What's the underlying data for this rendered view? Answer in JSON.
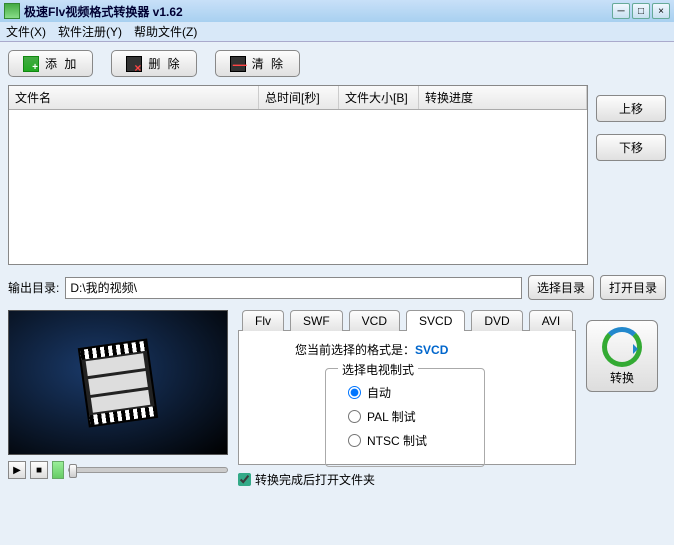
{
  "window": {
    "title": "极速Flv视频格式转换器  v1.62"
  },
  "menu": {
    "file": "文件(X)",
    "register": "软件注册(Y)",
    "help": "帮助文件(Z)"
  },
  "toolbar": {
    "add": "添 加",
    "delete": "删 除",
    "clear": "清 除"
  },
  "columns": {
    "name": "文件名",
    "duration": "总时间[秒]",
    "size": "文件大小[B]",
    "progress": "转换进度"
  },
  "side": {
    "up": "上移",
    "down": "下移"
  },
  "output": {
    "label": "输出目录:",
    "path": "D:\\我的视频\\",
    "choose": "选择目录",
    "open": "打开目录"
  },
  "tabs": {
    "flv": "Flv",
    "swf": "SWF",
    "vcd": "VCD",
    "svcd": "SVCD",
    "dvd": "DVD",
    "avi": "AVI"
  },
  "panel": {
    "current_prefix": "您当前选择的格式是：",
    "current_format": "SVCD",
    "tv_legend": "选择电视制式",
    "opt_auto": "自动",
    "opt_pal": "PAL 制试",
    "opt_ntsc": "NTSC 制试"
  },
  "convert": {
    "label": "转换"
  },
  "after": {
    "label": "转换完成后打开文件夹"
  }
}
